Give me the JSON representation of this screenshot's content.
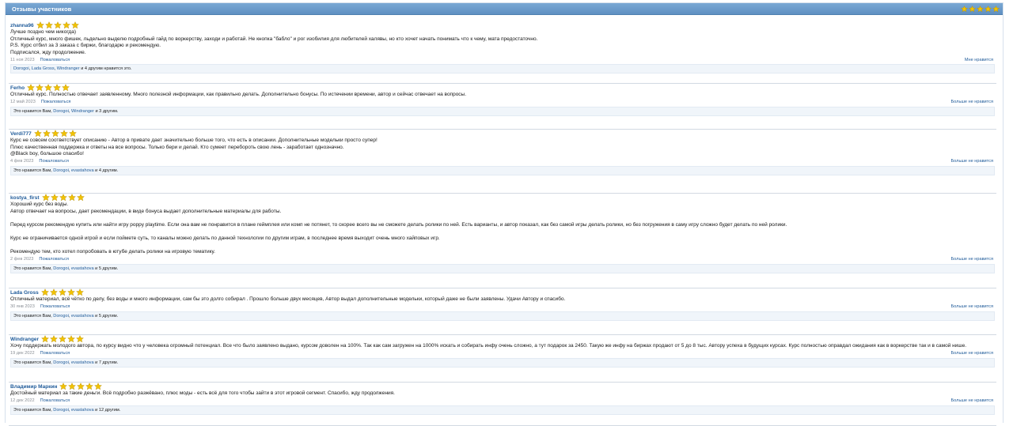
{
  "panel": {
    "title": "Отзывы участников",
    "header_stars": 5,
    "star_color": "#f2c200"
  },
  "reviews": [
    {
      "author": "zhanna96",
      "stars": 5,
      "text": "Лучше поздно чем никогда)\nОтличный курс, много фишек, льдельно выделю подробный гайд по воркерству, заходи и работай. Не кнопка \"бабло\" и рог изобилия для любителей халявы, но кто хочет начать понимать что к чему, мата предостаточно.\nP.S. Курс отбил за 3 заказа с биржи, благодарю и рекомендую.\nПодписался, жду продолжение.",
      "date": "11 ноя 2023",
      "complain": "Пожаловаться",
      "like_action": "Мне нравится",
      "likes_prefix": "",
      "likes_users": [
        "Dorogoi",
        "Lada Gross",
        "Windranger"
      ],
      "likes_suffix": "и 4 другим нравится это."
    },
    {
      "author": "Ferho",
      "stars": 5,
      "text": "Отличный курс. Полностью отвечает заявленному. Много полезной информации, как правильно делать. Дополнительно бонусы. По истечении времени, автор и сейчас отвечает на вопросы.",
      "date": "12 май 2023",
      "complain": "Пожаловаться",
      "like_action": "Больше не нравится",
      "likes_prefix": "Это нравится Вам,",
      "likes_users": [
        "Dorogoi",
        "Windranger"
      ],
      "likes_suffix": "и 3 другим."
    },
    {
      "author": "Verdi777",
      "stars": 5,
      "text": "Курс не совсем соответствует описанию - Автор в привате дает значительно больше того, что есть в описании. Дополнительные модельки просто супер!\nПлюс качественная поддержка и ответы на все вопросы. Только бери и делай. Кто сумеет перебороть свою лень - заработает однозначно.\n@Black boy, большое спасибо!",
      "date": "4 фев 2023",
      "complain": "Пожаловаться",
      "like_action": "Больше не нравится",
      "likes_prefix": "Это нравится Вам,",
      "likes_users": [
        "Dorogoi",
        "evastahova"
      ],
      "likes_suffix": "и 4 другим."
    },
    {
      "author": "kostya_first",
      "stars": 5,
      "text": "Хороший курс без воды.\nАвтор отвечает на вопросы, дает рекомендации, в виде бонуса выдает дополнительные материалы для работы.\n\nПеред курсом рекомендую купить или найти игру poppy playtime. Если она вам не понравится в плане геймплея или комп не потянет, то скорее всего вы не сможете делать ролики по ней. Есть варианты, и автор показал, как без самой игры делать ролики, но без погружения в саму игру сложно будет делать по ней ролики.\n\nКурс не ограничивается одной игрой и если поймете суть, то каналы можно делать по данной технологии по другим играм, в последнее время выходит очень много хайповых игр.\n\nРекомендую тем, кто хотел попробовать в ютубе делать ролики на игровую тематику.",
      "date": "2 фев 2023",
      "complain": "Пожаловаться",
      "like_action": "Больше не нравится",
      "likes_prefix": "Это нравится Вам,",
      "likes_users": [
        "Dorogoi",
        "evastahova"
      ],
      "likes_suffix": "и 5 другим."
    },
    {
      "author": "Lada Gross",
      "stars": 5,
      "text": "Отличный материал, всё чётко по делу, без воды и много информации, сам бы это долго собирал . Прошло больше двух месяцев, Автор выдал дополнительные модельки, который даже не были заявлены. Удачи Автору и спасибо.",
      "date": "30 янв 2023",
      "complain": "Пожаловаться",
      "like_action": "Больше не нравится",
      "likes_prefix": "Это нравится Вам,",
      "likes_users": [
        "Dorogoi",
        "evastahova"
      ],
      "likes_suffix": "и 5 другим."
    },
    {
      "author": "Windranger",
      "stars": 5,
      "text": "Хочу поддержать молодого автора, по курсу видно что у человека огромный потенциал. Все что было заявлено выдано, курсом доволен на 100%. Так как сам загружен на 1000% искать и собирать инфу очень сложно, а тут подарок за 2450. Такую же инфу на биржах продают от 5 до 8 тыс. Автору успеха в будущих курсах. Курс полностью оправдал ожидания как в воркерстве так и в самой нише.",
      "date": "19 дек 2022",
      "complain": "Пожаловаться",
      "like_action": "Больше не нравится",
      "likes_prefix": "Это нравится Вам,",
      "likes_users": [
        "Dorogoi",
        "evastahova"
      ],
      "likes_suffix": "и 7 другим."
    },
    {
      "author": "Владимир Маркин",
      "stars": 5,
      "text": "Достойный материал за такие деньги. Всё подробно разжёвано, плюс моды - есть всё для того чтобы зайти в этот игровой сегмент. Спасибо, жду продолжения.",
      "date": "12 дек 2022",
      "complain": "Пожаловаться",
      "like_action": "Больше не нравится",
      "likes_prefix": "Это нравится Вам,",
      "likes_users": [
        "Dorogoi",
        "evastahova"
      ],
      "likes_suffix": "и 12 другим."
    }
  ]
}
